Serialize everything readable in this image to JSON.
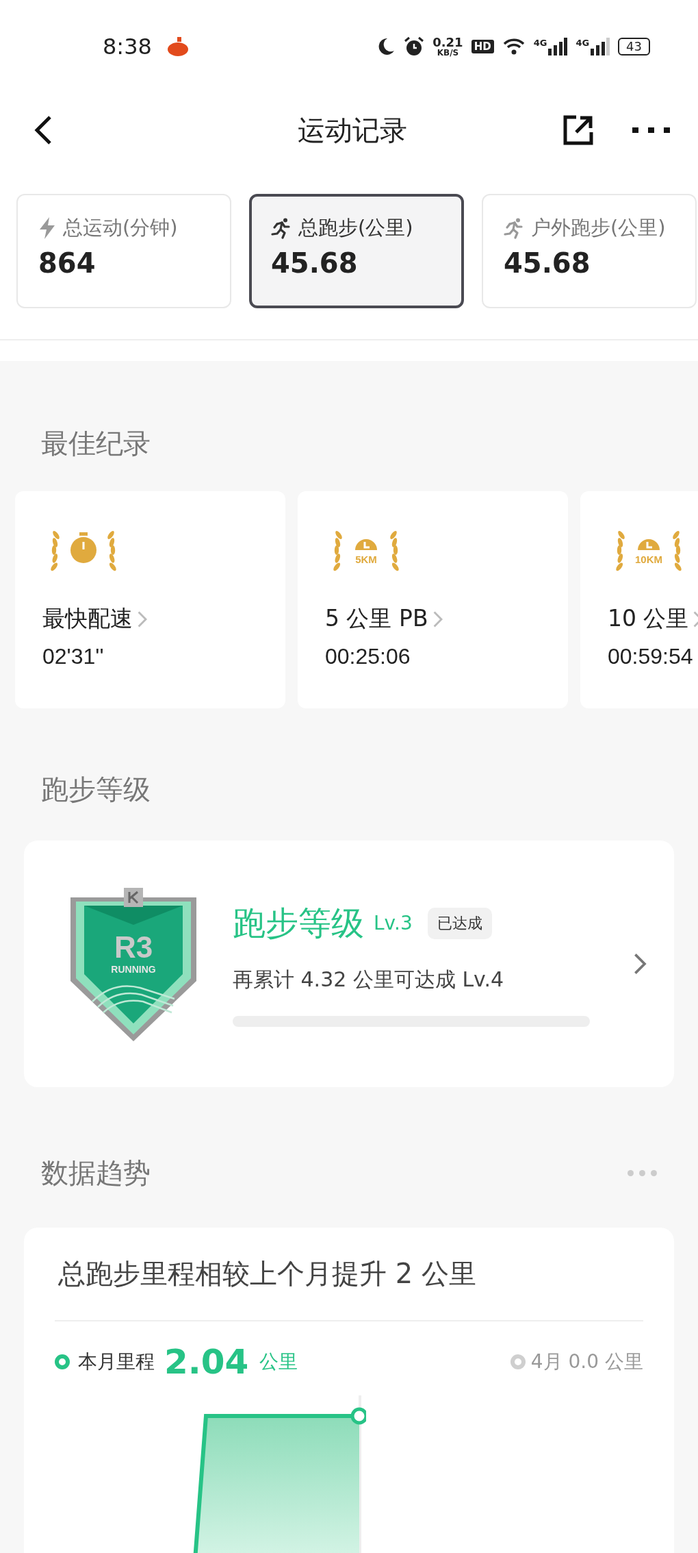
{
  "status_bar": {
    "time": "8:38",
    "speed": "0.21",
    "speed_unit": "KB/S",
    "hd": "HD",
    "network_1": "4G",
    "network_2": "4G",
    "battery": "43"
  },
  "nav": {
    "title": "运动记录"
  },
  "tabs": [
    {
      "kind": "bolt",
      "label": "总运动(分钟)",
      "value": "864",
      "selected": false
    },
    {
      "kind": "runner",
      "label": "总跑步(公里)",
      "value": "45.68",
      "selected": true
    },
    {
      "kind": "runner",
      "label": "户外跑步(公里)",
      "value": "45.68",
      "selected": false
    }
  ],
  "best_records": {
    "heading": "最佳纪录",
    "items": [
      {
        "kind": "stopwatch",
        "label": "最快配速",
        "value": "02'31''"
      },
      {
        "kind": "distance",
        "medal_text": "5KM",
        "label": "5 公里 PB",
        "value": "00:25:06"
      },
      {
        "kind": "distance",
        "medal_text": "10KM",
        "label": "10 公里",
        "value": "00:59:54"
      }
    ]
  },
  "running_level": {
    "heading": "跑步等级",
    "badge_code": "R3",
    "badge_caption": "RUNNING",
    "title": "跑步等级",
    "level_label": "Lv.3",
    "status": "已达成",
    "hint": "再累计 4.32 公里可达成 Lv.4",
    "level": 0
  },
  "trends": {
    "heading": "数据趋势",
    "card_title": "总跑步里程相较上个月提升 2 公里",
    "current_label": "本月里程",
    "current_value": "2.04",
    "current_unit": "公里",
    "previous_label": "4月 0.0 公里"
  }
}
